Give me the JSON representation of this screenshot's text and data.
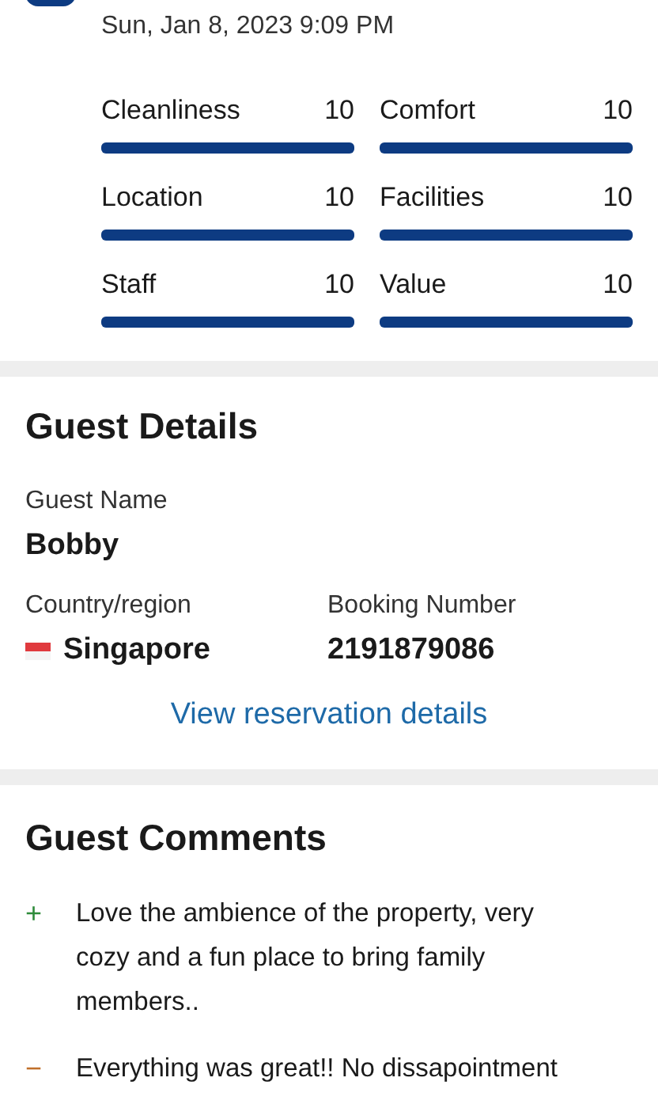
{
  "review": {
    "date": "Sun, Jan 8, 2023 9:09 PM",
    "ratings": [
      {
        "label": "Cleanliness",
        "score": "10",
        "level": 1
      },
      {
        "label": "Comfort",
        "score": "10",
        "level": 1
      },
      {
        "label": "Location",
        "score": "10",
        "level": 1
      },
      {
        "label": "Facilities",
        "score": "10",
        "level": 1
      },
      {
        "label": "Staff",
        "score": "10",
        "level": 1
      },
      {
        "label": "Value",
        "score": "10",
        "level": 1
      }
    ]
  },
  "guest_details": {
    "title": "Guest Details",
    "name_label": "Guest Name",
    "name": "Bobby",
    "country_label": "Country/region",
    "country": "Singapore",
    "booking_label": "Booking Number",
    "booking_number": "2191879086",
    "link": "View reservation details"
  },
  "guest_comments": {
    "title": "Guest Comments",
    "comments": [
      {
        "kind": "positive",
        "sign": "+",
        "text": "Love the ambience of the property, very cozy and a fun place to bring family members.."
      },
      {
        "kind": "negative",
        "sign": "−",
        "text": "Everything was great!! No dissapointment"
      }
    ]
  }
}
